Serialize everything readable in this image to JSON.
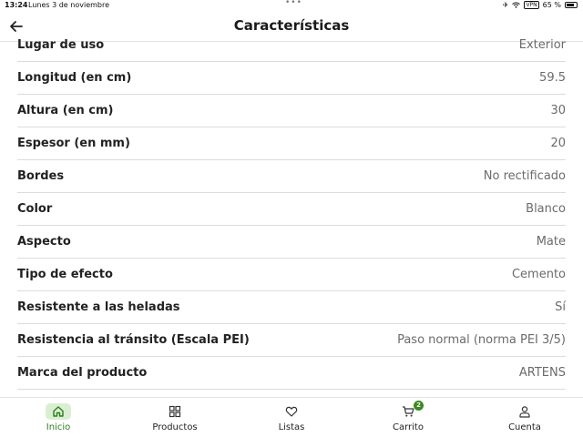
{
  "status_bar": {
    "time": "13:24",
    "date": "Lunes 3 de noviembre",
    "vpn": "VPN",
    "battery": "65 %"
  },
  "header": {
    "title": "Características",
    "back_icon": "arrow-left-icon"
  },
  "characteristics": [
    {
      "label": "Lugar de uso",
      "value": "Exterior"
    },
    {
      "label": "Longitud (en cm)",
      "value": "59.5"
    },
    {
      "label": "Altura (en cm)",
      "value": "30"
    },
    {
      "label": "Espesor (en mm)",
      "value": "20"
    },
    {
      "label": "Bordes",
      "value": "No rectificado"
    },
    {
      "label": "Color",
      "value": "Blanco"
    },
    {
      "label": "Aspecto",
      "value": "Mate"
    },
    {
      "label": "Tipo de efecto",
      "value": "Cemento"
    },
    {
      "label": "Resistente a las heladas",
      "value": "Sí"
    },
    {
      "label": "Resistencia al tránsito (Escala PEI)",
      "value": "Paso normal (norma PEI 3/5)"
    },
    {
      "label": "Marca del producto",
      "value": "ARTENS"
    }
  ],
  "tabbar": {
    "items": [
      {
        "label": "Inicio",
        "icon": "home-icon",
        "active": true
      },
      {
        "label": "Productos",
        "icon": "grid-icon",
        "active": false
      },
      {
        "label": "Listas",
        "icon": "heart-icon",
        "active": false
      },
      {
        "label": "Carrito",
        "icon": "cart-icon",
        "active": false,
        "badge": "2"
      },
      {
        "label": "Cuenta",
        "icon": "user-icon",
        "active": false
      }
    ]
  },
  "colors": {
    "accent": "#2e7d1e",
    "accent_bg": "#d9efd2",
    "badge": "#3a8a1f"
  }
}
